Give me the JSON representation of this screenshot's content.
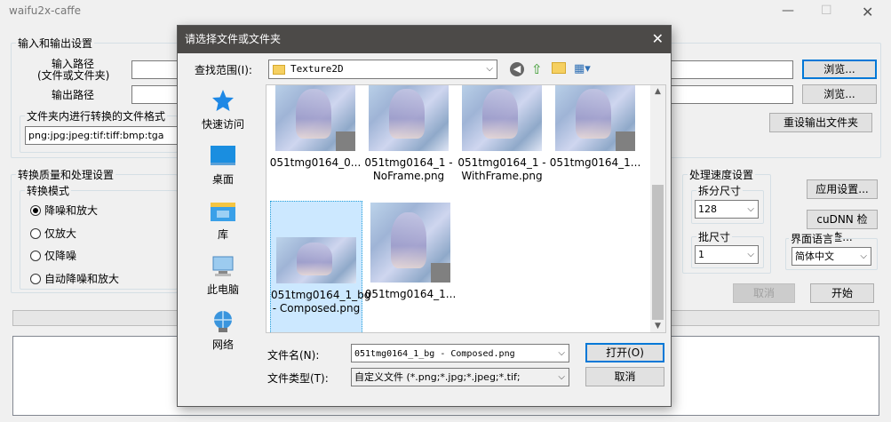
{
  "main": {
    "title": "waifu2x-caffe",
    "io_group": "输入和输出设置",
    "input_path_label_1": "输入路径",
    "input_path_label_2": "(文件或文件夹)",
    "output_path_label": "输出路径",
    "browse_1": "浏览...",
    "browse_2": "浏览...",
    "folder_format_label": "文件夹内进行转换的文件格式",
    "folder_format_value": "png:jpg:jpeg:tif:tiff:bmp:tga",
    "reset_output_folder": "重设输出文件夹",
    "quality_group": "转换质量和处理设置",
    "mode_group": "转换模式",
    "modes": [
      "降噪和放大",
      "仅放大",
      "仅降噪",
      "自动降噪和放大"
    ],
    "speed_group": "处理速度设置",
    "split_size_label": "拆分尺寸",
    "split_size_value": "128",
    "batch_size_label": "批尺寸",
    "batch_size_value": "1",
    "apply_settings": "应用设置...",
    "cudnn_check": "cuDNN 检查...",
    "ui_language_label": "界面语言",
    "ui_language_value": "简体中文",
    "cancel": "取消",
    "start": "开始"
  },
  "dialog": {
    "title": "请选择文件或文件夹",
    "look_in_label": "查找范围(I):",
    "look_in_value": "Texture2D",
    "places": [
      "快速访问",
      "桌面",
      "库",
      "此电脑",
      "网络"
    ],
    "files": [
      "051tmg0164_0...",
      "051tmg0164_1 - NoFrame.png",
      "051tmg0164_1 - WithFrame.png",
      "051tmg0164_1...",
      "051tmg0164_1_bg - Composed.png",
      "051tmg0164_1..."
    ],
    "filename_label": "文件名(N):",
    "filename_value": "051tmg0164_1_bg - Composed.png",
    "filetype_label": "文件类型(T):",
    "filetype_value": "自定义文件 (*.png;*.jpg;*.jpeg;*.tif;",
    "open_button": "打开(O)",
    "cancel_button": "取消"
  },
  "colors": {
    "dialog_titlebar": "#4c4a48",
    "selection": "#cce8ff",
    "focus": "#0078d7"
  }
}
